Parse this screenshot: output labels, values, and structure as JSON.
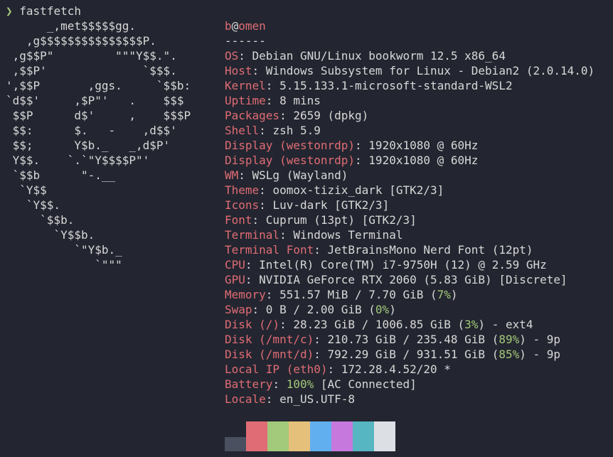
{
  "prompt": {
    "arrow": "❯",
    "command": "fastfetch"
  },
  "logo_lines": [
    "      _,met$$$$$gg.",
    "   ,g$$$$$$$$$$$$$$$P.",
    " ,g$$P\"         \"\"\"Y$$.\".",
    " ,$$P'              `$$$.",
    "',$$P       ,ggs.     `$$b:",
    "`d$$'     ,$P\"'   .    $$$",
    " $$P      d$'     ,    $$$P",
    " $$:      $.   -    ,d$$'",
    " $$;      Y$b._   _,d$P'",
    " Y$$.    `.`\"Y$$$$P\"'",
    " `$$b      \"-.__",
    "  `Y$$",
    "   `Y$$.",
    "     `$$b.",
    "       `Y$$b.",
    "          `\"Y$b._",
    "             `\"\"\""
  ],
  "header": {
    "user": "b",
    "at": "@",
    "host": "omen",
    "separator": "------"
  },
  "info": [
    {
      "key": "OS",
      "value": "Debian GNU/Linux bookworm 12.5 x86_64"
    },
    {
      "key": "Host",
      "value": "Windows Subsystem for Linux - Debian2 (2.0.14.0)"
    },
    {
      "key": "Kernel",
      "value": "5.15.133.1-microsoft-standard-WSL2"
    },
    {
      "key": "Uptime",
      "value": "8 mins"
    },
    {
      "key": "Packages",
      "value": "2659 (dpkg)"
    },
    {
      "key": "Shell",
      "value": "zsh 5.9"
    },
    {
      "key": "Display (westonrdp)",
      "value": "1920x1080 @ 60Hz"
    },
    {
      "key": "Display (westonrdp)",
      "value": "1920x1080 @ 60Hz"
    },
    {
      "key": "WM",
      "value": "WSLg (Wayland)"
    },
    {
      "key": "Theme",
      "value": "oomox-tizix_dark [GTK2/3]"
    },
    {
      "key": "Icons",
      "value": "Luv-dark [GTK2/3]"
    },
    {
      "key": "Font",
      "value": "Cuprum (13pt) [GTK2/3]"
    },
    {
      "key": "Terminal",
      "value": "Windows Terminal"
    },
    {
      "key": "Terminal Font",
      "value": "JetBrainsMono Nerd Font (12pt)"
    },
    {
      "key": "CPU",
      "value": "Intel(R) Core(TM) i7-9750H (12) @ 2.59 GHz"
    },
    {
      "key": "GPU",
      "value": "NVIDIA GeForce RTX 2060 (5.83 GiB) [Discrete]"
    },
    {
      "key": "Memory",
      "value_pre": "551.57 MiB / 7.70 GiB (",
      "pct": "7%",
      "value_post": ")"
    },
    {
      "key": "Swap",
      "value_pre": "0 B / 2.00 GiB (",
      "pct": "0%",
      "value_post": ")"
    },
    {
      "key": "Disk (/)",
      "value_pre": "28.23 GiB / 1006.85 GiB (",
      "pct": "3%",
      "value_post": ") - ext4"
    },
    {
      "key": "Disk (/mnt/c)",
      "value_pre": "210.73 GiB / 235.48 GiB (",
      "pct": "89%",
      "value_post": ") - 9p"
    },
    {
      "key": "Disk (/mnt/d)",
      "value_pre": "792.29 GiB / 931.51 GiB (",
      "pct": "85%",
      "value_post": ") - 9p"
    },
    {
      "key": "Local IP (eth0)",
      "value": "172.28.4.52/20 *"
    },
    {
      "key": "Battery",
      "value_pre": "",
      "pct": "100%",
      "value_post": " [AC Connected]"
    },
    {
      "key": "Locale",
      "value": "en_US.UTF-8"
    }
  ],
  "palette": [
    {
      "color": "#4a5060",
      "size": "short"
    },
    {
      "color": "#4a5060",
      "size": "short"
    },
    {
      "color": "#4a5060",
      "size": "short"
    },
    {
      "color": "#e06c75",
      "size": "tall"
    },
    {
      "color": "#e06c75",
      "size": "tall"
    },
    {
      "color": "#e06c75",
      "size": "tall"
    },
    {
      "color": "#a3c97a",
      "size": "tall"
    },
    {
      "color": "#a3c97a",
      "size": "tall"
    },
    {
      "color": "#a3c97a",
      "size": "tall"
    },
    {
      "color": "#e5c07b",
      "size": "tall"
    },
    {
      "color": "#e5c07b",
      "size": "tall"
    },
    {
      "color": "#e5c07b",
      "size": "tall"
    },
    {
      "color": "#61afef",
      "size": "tall"
    },
    {
      "color": "#61afef",
      "size": "tall"
    },
    {
      "color": "#61afef",
      "size": "tall"
    },
    {
      "color": "#c678dd",
      "size": "tall"
    },
    {
      "color": "#c678dd",
      "size": "tall"
    },
    {
      "color": "#c678dd",
      "size": "tall"
    },
    {
      "color": "#56b6c2",
      "size": "tall"
    },
    {
      "color": "#56b6c2",
      "size": "tall"
    },
    {
      "color": "#56b6c2",
      "size": "tall"
    },
    {
      "color": "#dcdfe4",
      "size": "tall"
    },
    {
      "color": "#dcdfe4",
      "size": "tall"
    },
    {
      "color": "#dcdfe4",
      "size": "tall"
    }
  ]
}
